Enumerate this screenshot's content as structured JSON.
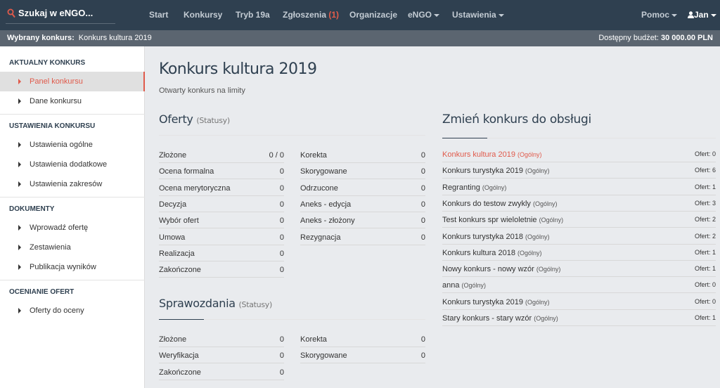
{
  "topnav": {
    "search_label": "Szukaj w eNGO...",
    "items": [
      {
        "label": "Start"
      },
      {
        "label": "Konkursy"
      },
      {
        "label": "Tryb 19a"
      },
      {
        "label": "Zgłoszenia",
        "count": "(1)"
      },
      {
        "label": "Organizacje"
      },
      {
        "label": "eNGO"
      },
      {
        "label": "Ustawienia"
      }
    ],
    "help_label": "Pomoc",
    "user_label": "Jan"
  },
  "subbar": {
    "selected_prefix": "Wybrany konkurs:",
    "selected_value": "Konkurs kultura 2019",
    "budget_prefix": "Dostępny budżet:",
    "budget_value": "30 000.00 PLN"
  },
  "sidebar": {
    "sections": [
      {
        "title": "AKTUALNY KONKURS",
        "items": [
          {
            "label": "Panel konkursu",
            "active": true
          },
          {
            "label": "Dane konkursu"
          }
        ]
      },
      {
        "title": "USTAWIENIA KONKURSU",
        "items": [
          {
            "label": "Ustawienia ogólne"
          },
          {
            "label": "Ustawienia dodatkowe"
          },
          {
            "label": "Ustawienia zakresów"
          }
        ]
      },
      {
        "title": "DOKUMENTY",
        "items": [
          {
            "label": "Wprowadź ofertę"
          },
          {
            "label": "Zestawienia"
          },
          {
            "label": "Publikacja wyników"
          }
        ]
      },
      {
        "title": "OCENIANIE OFERT",
        "items": [
          {
            "label": "Oferty do oceny"
          }
        ]
      }
    ]
  },
  "main": {
    "title": "Konkurs kultura 2019",
    "subtitle": "Otwarty konkurs na limity",
    "offers": {
      "title": "Oferty",
      "subtitle": "(Statusy)",
      "left": [
        {
          "name": "Złożone",
          "value": "0 / 0"
        },
        {
          "name": "Ocena formalna",
          "value": "0"
        },
        {
          "name": "Ocena merytoryczna",
          "value": "0"
        },
        {
          "name": "Decyzja",
          "value": "0"
        },
        {
          "name": "Wybór ofert",
          "value": "0"
        },
        {
          "name": "Umowa",
          "value": "0"
        },
        {
          "name": "Realizacja",
          "value": "0"
        },
        {
          "name": "Zakończone",
          "value": "0"
        }
      ],
      "right": [
        {
          "name": "Korekta",
          "value": "0"
        },
        {
          "name": "Skorygowane",
          "value": "0"
        },
        {
          "name": "Odrzucone",
          "value": "0"
        },
        {
          "name": "Aneks - edycja",
          "value": "0"
        },
        {
          "name": "Aneks - złożony",
          "value": "0"
        },
        {
          "name": "Rezygnacja",
          "value": "0"
        }
      ]
    },
    "reports": {
      "title": "Sprawozdania",
      "subtitle": "(Statusy)",
      "left": [
        {
          "name": "Złożone",
          "value": "0"
        },
        {
          "name": "Weryfikacja",
          "value": "0"
        },
        {
          "name": "Zakończone",
          "value": "0"
        }
      ],
      "right": [
        {
          "name": "Korekta",
          "value": "0"
        },
        {
          "name": "Skorygowane",
          "value": "0"
        }
      ]
    },
    "change": {
      "title": "Zmień konkurs do obsługi",
      "contests": [
        {
          "name": "Konkurs kultura 2019",
          "type": "(Ogólny)",
          "offers": "Ofert: 0",
          "current": true
        },
        {
          "name": "Konkurs turystyka 2019",
          "type": "(Ogólny)",
          "offers": "Ofert: 6"
        },
        {
          "name": "Regranting",
          "type": "(Ogólny)",
          "offers": "Ofert: 1"
        },
        {
          "name": "Konkurs do testow zwykly",
          "type": "(Ogólny)",
          "offers": "Ofert: 3"
        },
        {
          "name": "Test konkurs spr wieloletnie",
          "type": "(Ogólny)",
          "offers": "Ofert: 2"
        },
        {
          "name": "Konkurs turystyka 2018",
          "type": "(Ogólny)",
          "offers": "Ofert: 2"
        },
        {
          "name": "Konkurs kultura 2018",
          "type": "(Ogólny)",
          "offers": "Ofert: 1"
        },
        {
          "name": "Nowy konkurs - nowy wzór",
          "type": "(Ogólny)",
          "offers": "Ofert: 1"
        },
        {
          "name": "anna",
          "type": "(Ogólny)",
          "offers": "Ofert: 0"
        },
        {
          "name": "Konkurs turystyka 2019",
          "type": "(Ogólny)",
          "offers": "Ofert: 0"
        },
        {
          "name": "Stary konkurs - stary wzór",
          "type": "(Ogólny)",
          "offers": "Ofert: 1"
        }
      ]
    }
  },
  "colors": {
    "nav_bg": "#2f4050",
    "subbar_bg": "#5b6570",
    "accent": "#e05a4b",
    "page_bg": "#e9ebee"
  }
}
